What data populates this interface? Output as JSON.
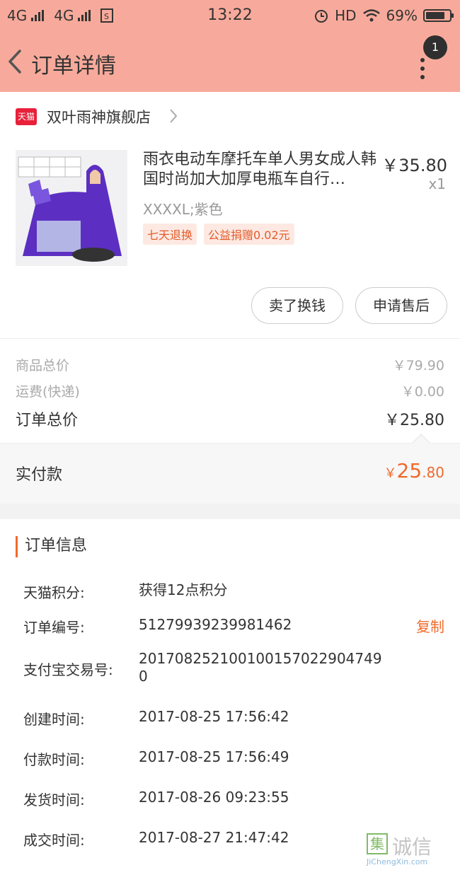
{
  "status": {
    "carrier1": "4G",
    "carrier2": "4G",
    "time": "13:22",
    "hd": "HD",
    "battery": "69%"
  },
  "nav": {
    "title": "订单详情",
    "badge": "1"
  },
  "store": {
    "badge": "天猫",
    "name": "双叶雨神旗舰店"
  },
  "product": {
    "title": "雨衣电动车摩托车单人男女成人韩国时尚加大加厚电瓶车自行…",
    "price": "￥35.80",
    "qty": "x1",
    "sku": "XXXXL;紫色",
    "tags": [
      "七天退换",
      "公益捐赠0.02元"
    ],
    "actions": [
      "卖了换钱",
      "申请售后"
    ]
  },
  "summary": {
    "goods_label": "商品总价",
    "goods_value": "￥79.90",
    "shipping_label": "运费(快递)",
    "shipping_value": "￥0.00",
    "total_label": "订单总价",
    "total_value": "￥25.80",
    "paid_label": "实付款",
    "paid_currency": "￥",
    "paid_int": "25",
    "paid_dec": ".80"
  },
  "order_info": {
    "title": "订单信息",
    "copy_label": "复制",
    "rows": [
      {
        "label": "天猫积分:",
        "value": "获得12点积分"
      },
      {
        "label": "订单编号:",
        "value": "51279939239981462"
      },
      {
        "label": "支付宝交易号:",
        "value": "2017082521001001570229047490"
      },
      {
        "label": "创建时间:",
        "value": "2017-08-25 17:56:42"
      },
      {
        "label": "付款时间:",
        "value": "2017-08-25 17:56:49"
      },
      {
        "label": "发货时间:",
        "value": "2017-08-26 09:23:55"
      },
      {
        "label": "成交时间:",
        "value": "2017-08-27 21:47:42"
      }
    ]
  },
  "watermark": {
    "mark": "集",
    "text": "诚信",
    "url": "JiChengXin.com"
  },
  "colors": {
    "header": "#f7aa9b",
    "accent": "#ef6a2b",
    "tmall": "#e8203a"
  }
}
